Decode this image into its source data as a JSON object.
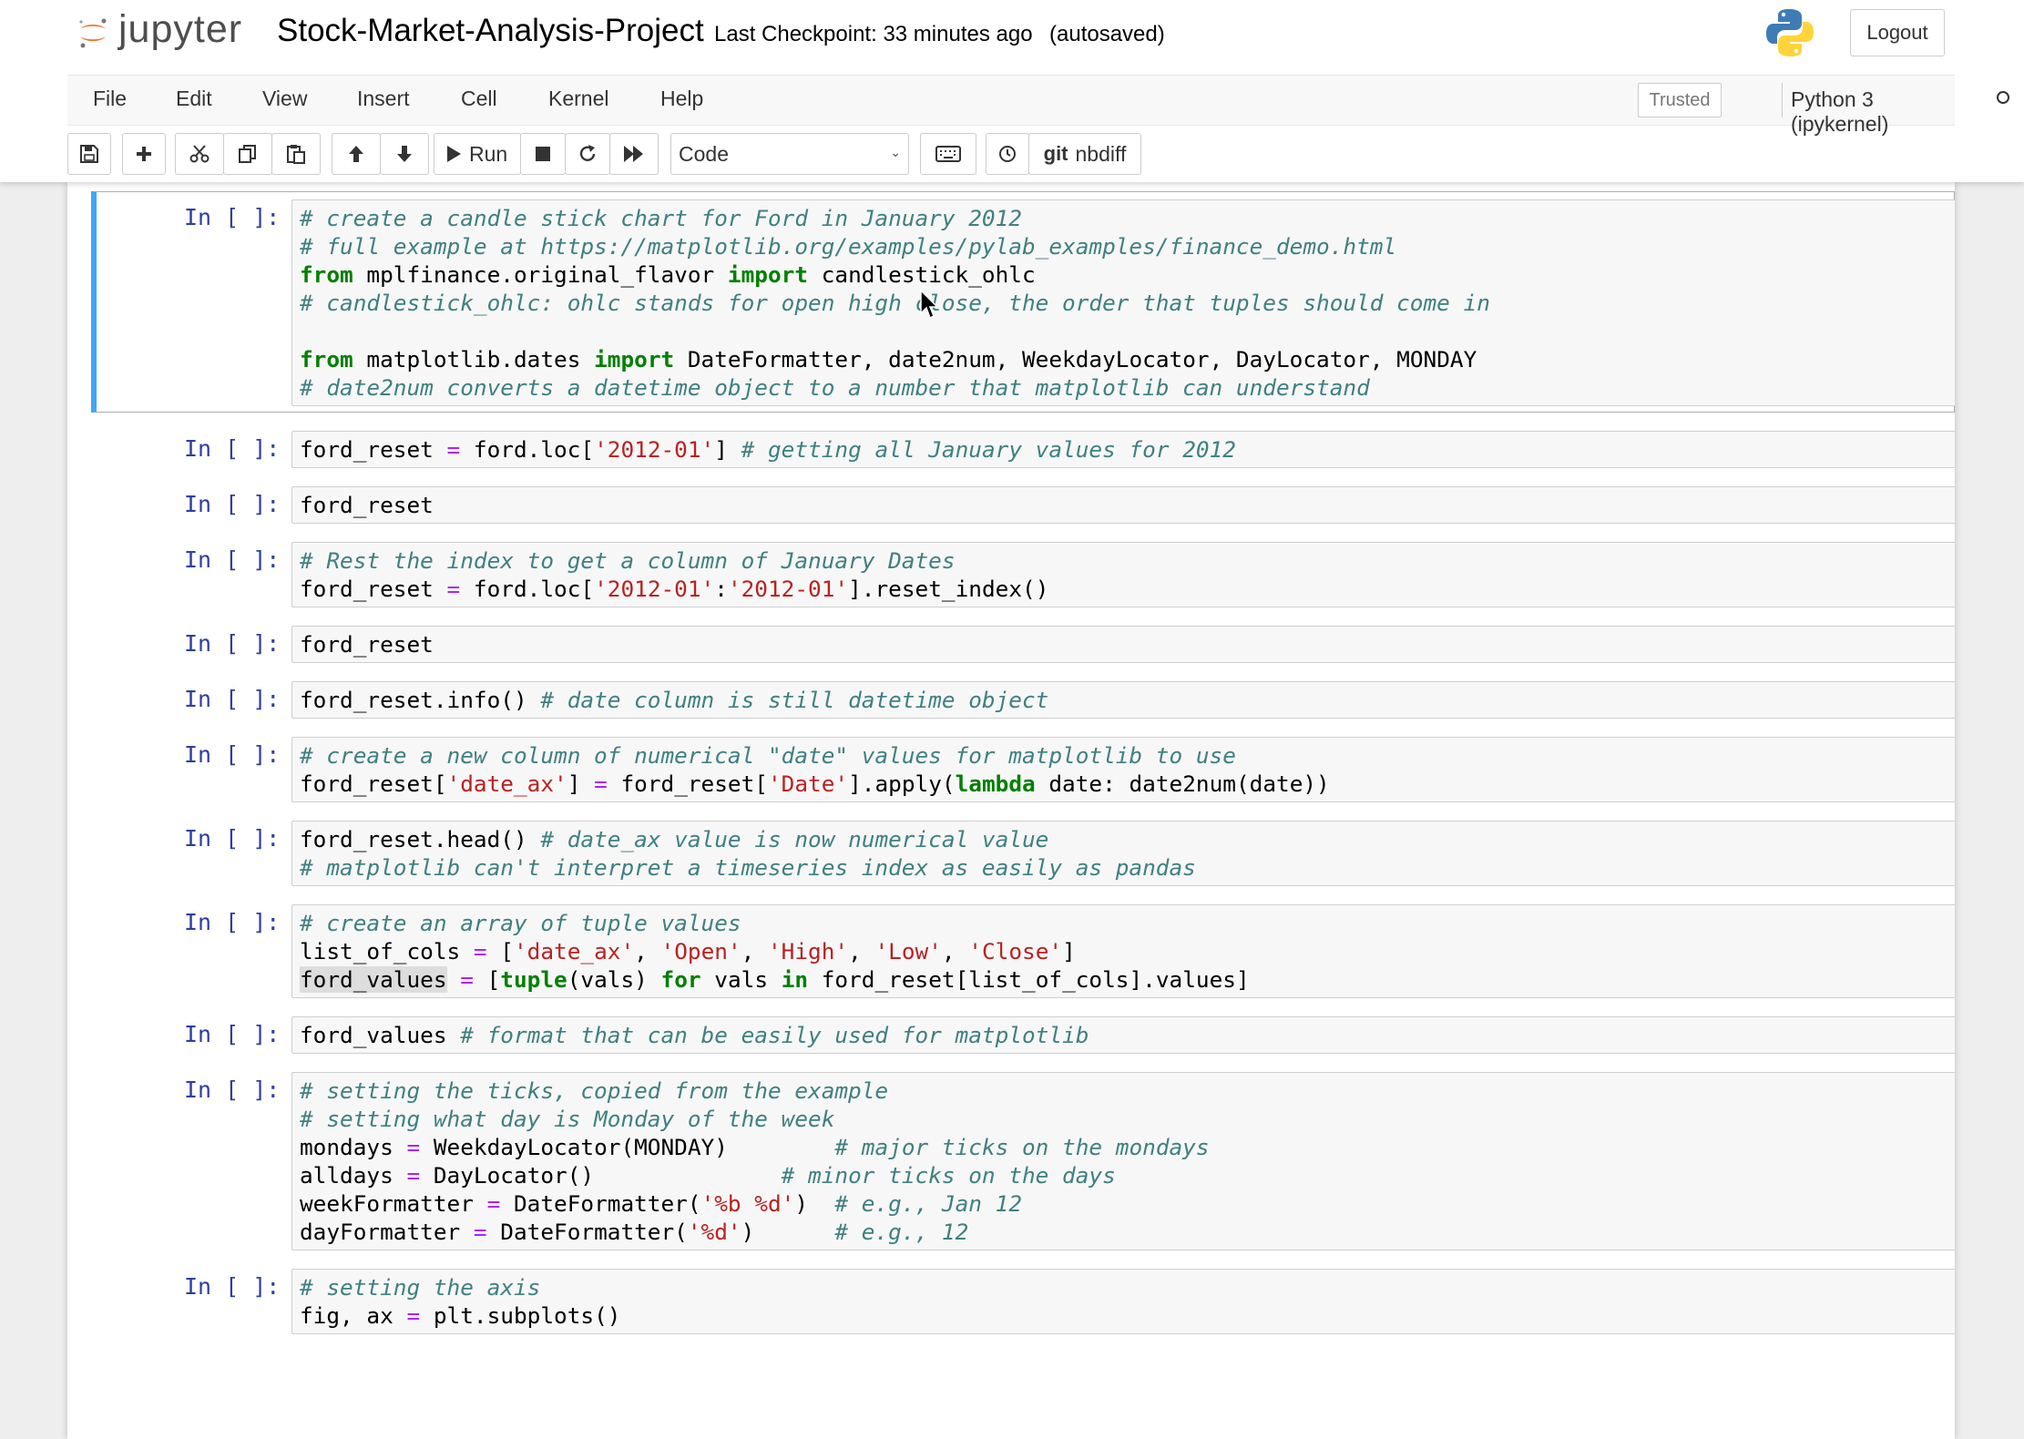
{
  "header": {
    "logo_text": "jupyter",
    "notebook_name": "Stock-Market-Analysis-Project",
    "checkpoint": "Last Checkpoint: 33 minutes ago",
    "autosave_status": "(autosaved)",
    "logout_label": "Logout"
  },
  "menubar": {
    "items": [
      "File",
      "Edit",
      "View",
      "Insert",
      "Cell",
      "Kernel",
      "Help"
    ],
    "trusted_label": "Trusted",
    "kernel_name": "Python 3 (ipykernel)"
  },
  "toolbar": {
    "run_label": "Run",
    "cell_type": "Code",
    "nbdiff_label": "nbdiff",
    "git_label": "git",
    "icons": [
      "save-icon",
      "plus-icon",
      "scissors-icon",
      "copy-icon",
      "paste-icon",
      "arrow-up-icon",
      "arrow-down-icon",
      "play-icon",
      "stop-icon",
      "restart-icon",
      "fast-forward-icon",
      "keyboard-icon",
      "history-icon"
    ]
  },
  "cells": [
    {
      "prompt": "In [ ]:",
      "selected": true,
      "lines": [
        [
          [
            "c",
            "# create a candle stick chart for Ford in January 2012"
          ]
        ],
        [
          [
            "c",
            "# full example at https://matplotlib.org/examples/pylab_examples/finance_demo.html"
          ]
        ],
        [
          [
            "k",
            "from"
          ],
          [
            "",
            " mplfinance.original_flavor "
          ],
          [
            "k",
            "import"
          ],
          [
            "",
            " candlestick_ohlc"
          ]
        ],
        [
          [
            "c",
            "# candlestick_ohlc: ohlc stands for open high close, the order that tuples should come in"
          ]
        ],
        [
          [
            "",
            " "
          ]
        ],
        [
          [
            "k",
            "from"
          ],
          [
            "",
            " matplotlib.dates "
          ],
          [
            "k",
            "import"
          ],
          [
            "",
            " DateFormatter, date2num, WeekdayLocator, DayLocator, MONDAY"
          ]
        ],
        [
          [
            "c",
            "# date2num converts a datetime object to a number that matplotlib can understand"
          ]
        ]
      ]
    },
    {
      "prompt": "In [ ]:",
      "lines": [
        [
          [
            "",
            "ford_reset "
          ],
          [
            "o",
            "="
          ],
          [
            "",
            " ford.loc["
          ],
          [
            "s",
            "'2012-01'"
          ],
          [
            "",
            "] "
          ],
          [
            "c",
            "# getting all January values for 2012"
          ]
        ]
      ]
    },
    {
      "prompt": "In [ ]:",
      "lines": [
        [
          [
            "",
            "ford_reset"
          ]
        ]
      ]
    },
    {
      "prompt": "In [ ]:",
      "lines": [
        [
          [
            "c",
            "# Rest the index to get a column of January Dates"
          ]
        ],
        [
          [
            "",
            "ford_reset "
          ],
          [
            "o",
            "="
          ],
          [
            "",
            " ford.loc["
          ],
          [
            "s",
            "'2012-01'"
          ],
          [
            "",
            ":"
          ],
          [
            "s",
            "'2012-01'"
          ],
          [
            "",
            "].reset_index()"
          ]
        ]
      ]
    },
    {
      "prompt": "In [ ]:",
      "lines": [
        [
          [
            "",
            "ford_reset"
          ]
        ]
      ]
    },
    {
      "prompt": "In [ ]:",
      "lines": [
        [
          [
            "",
            "ford_reset.info() "
          ],
          [
            "c",
            "# date column is still datetime object"
          ]
        ]
      ]
    },
    {
      "prompt": "In [ ]:",
      "lines": [
        [
          [
            "c",
            "# create a new column of numerical \"date\" values for matplotlib to use"
          ]
        ],
        [
          [
            "",
            "ford_reset["
          ],
          [
            "s",
            "'date_ax'"
          ],
          [
            "",
            "] "
          ],
          [
            "o",
            "="
          ],
          [
            "",
            " ford_reset["
          ],
          [
            "s",
            "'Date'"
          ],
          [
            "",
            "].apply("
          ],
          [
            "k",
            "lambda"
          ],
          [
            "",
            " date: date2num(date))"
          ]
        ]
      ]
    },
    {
      "prompt": "In [ ]:",
      "lines": [
        [
          [
            "",
            "ford_reset.head() "
          ],
          [
            "c",
            "# date_ax value is now numerical value"
          ]
        ],
        [
          [
            "c",
            "# matplotlib can't interpret a timeseries index as easily as pandas"
          ]
        ]
      ]
    },
    {
      "prompt": "In [ ]:",
      "lines": [
        [
          [
            "c",
            "# create an array of tuple values"
          ]
        ],
        [
          [
            "",
            "list_of_cols "
          ],
          [
            "o",
            "="
          ],
          [
            "",
            " ["
          ],
          [
            "s",
            "'date_ax'"
          ],
          [
            "",
            ", "
          ],
          [
            "s",
            "'Open'"
          ],
          [
            "",
            ", "
          ],
          [
            "s",
            "'High'"
          ],
          [
            "",
            ", "
          ],
          [
            "s",
            "'Low'"
          ],
          [
            "",
            ", "
          ],
          [
            "s",
            "'Close'"
          ],
          [
            "",
            "]"
          ]
        ],
        [
          [
            "hl",
            "ford_values"
          ],
          [
            "",
            " "
          ],
          [
            "o",
            "="
          ],
          [
            "",
            " ["
          ],
          [
            "k",
            "tuple"
          ],
          [
            "",
            "(vals) "
          ],
          [
            "k",
            "for"
          ],
          [
            "",
            " vals "
          ],
          [
            "k",
            "in"
          ],
          [
            "",
            " ford_reset[list_of_cols].values]"
          ]
        ]
      ]
    },
    {
      "prompt": "In [ ]:",
      "lines": [
        [
          [
            "",
            "ford_values "
          ],
          [
            "c",
            "# format that can be easily used for matplotlib"
          ]
        ]
      ]
    },
    {
      "prompt": "In [ ]:",
      "lines": [
        [
          [
            "c",
            "# setting the ticks, copied from the example"
          ]
        ],
        [
          [
            "c",
            "# setting what day is Monday of the week"
          ]
        ],
        [
          [
            "",
            "mondays "
          ],
          [
            "o",
            "="
          ],
          [
            "",
            " WeekdayLocator(MONDAY)        "
          ],
          [
            "c",
            "# major ticks on the mondays"
          ]
        ],
        [
          [
            "",
            "alldays "
          ],
          [
            "o",
            "="
          ],
          [
            "",
            " DayLocator()              "
          ],
          [
            "c",
            "# minor ticks on the days"
          ]
        ],
        [
          [
            "",
            "weekFormatter "
          ],
          [
            "o",
            "="
          ],
          [
            "",
            " DateFormatter("
          ],
          [
            "s",
            "'%b %d'"
          ],
          [
            "",
            ")  "
          ],
          [
            "c",
            "# e.g., Jan 12"
          ]
        ],
        [
          [
            "",
            "dayFormatter "
          ],
          [
            "o",
            "="
          ],
          [
            "",
            " DateFormatter("
          ],
          [
            "s",
            "'%d'"
          ],
          [
            "",
            ")      "
          ],
          [
            "c",
            "# e.g., 12"
          ]
        ]
      ]
    },
    {
      "prompt": "In [ ]:",
      "lines": [
        [
          [
            "c",
            "# setting the axis"
          ]
        ],
        [
          [
            "",
            "fig, ax "
          ],
          [
            "o",
            "="
          ],
          [
            "",
            " plt.subplots()"
          ]
        ]
      ]
    }
  ]
}
